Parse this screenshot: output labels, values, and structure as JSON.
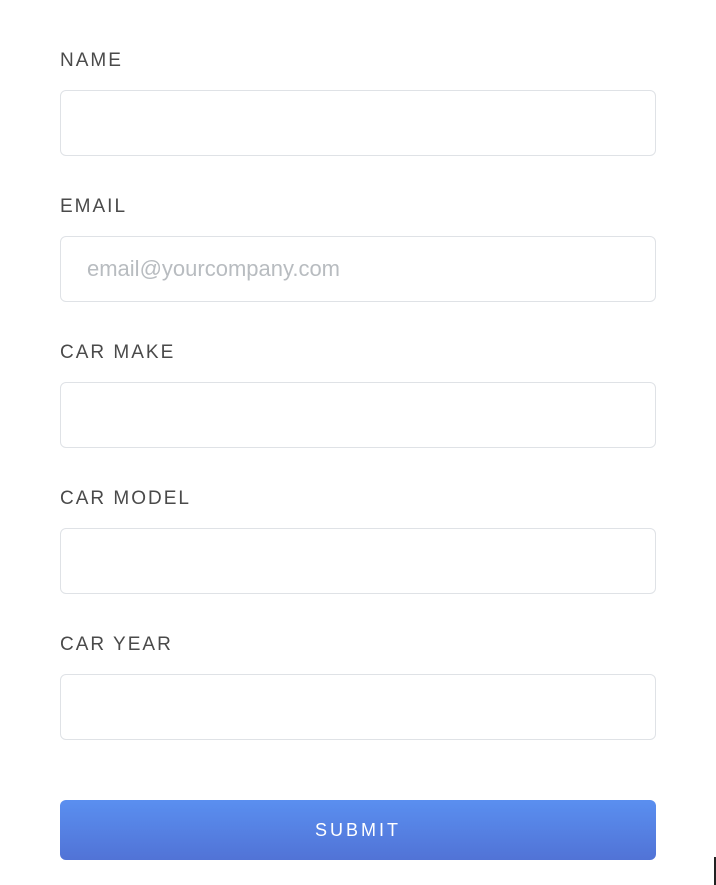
{
  "form": {
    "fields": {
      "name": {
        "label": "NAME",
        "value": "",
        "placeholder": ""
      },
      "email": {
        "label": "EMAIL",
        "value": "",
        "placeholder": "email@yourcompany.com"
      },
      "car_make": {
        "label": "CAR MAKE",
        "value": "",
        "placeholder": ""
      },
      "car_model": {
        "label": "CAR MODEL",
        "value": "",
        "placeholder": ""
      },
      "car_year": {
        "label": "CAR YEAR",
        "value": "",
        "placeholder": ""
      }
    },
    "submit_label": "SUBMIT"
  }
}
